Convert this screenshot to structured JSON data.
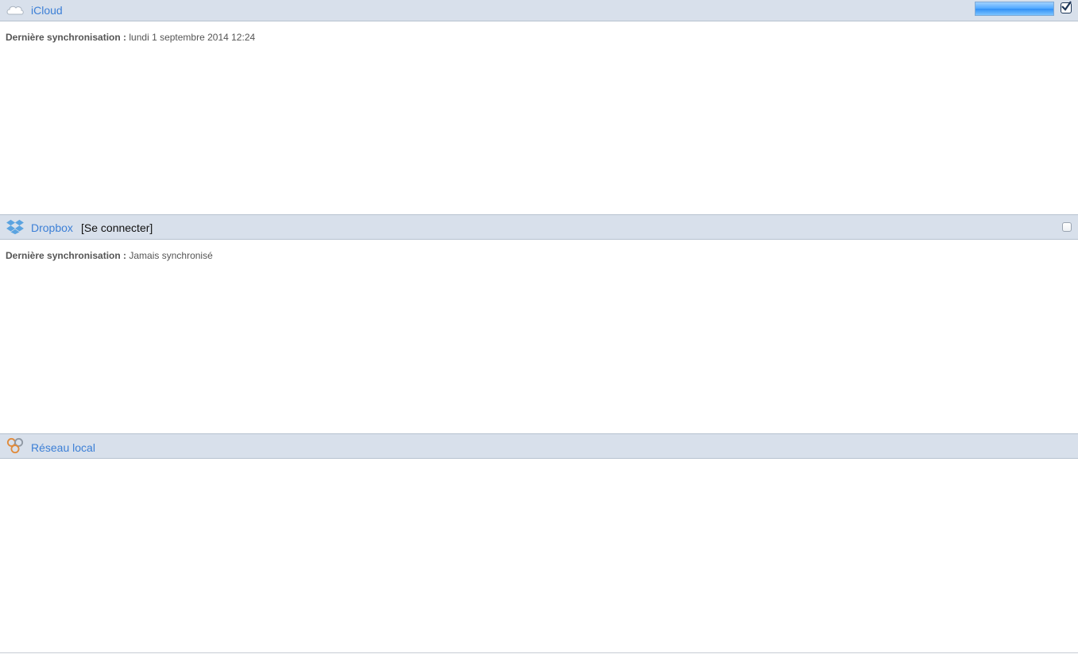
{
  "icloud": {
    "title": "iCloud",
    "progress_percent": 100,
    "enabled": true,
    "sync_label": "Dernière synchronisation :",
    "sync_value": " lundi 1 septembre 2014 12:24"
  },
  "dropbox": {
    "title": "Dropbox",
    "connect_label": "[Se connecter]",
    "enabled": false,
    "sync_label": "Dernière synchronisation :",
    "sync_value": " Jamais synchronisé"
  },
  "local_network": {
    "title": "Réseau local"
  },
  "colors": {
    "header_bg": "#d8e0eb",
    "link": "#3c7fd6",
    "text": "#555555"
  }
}
